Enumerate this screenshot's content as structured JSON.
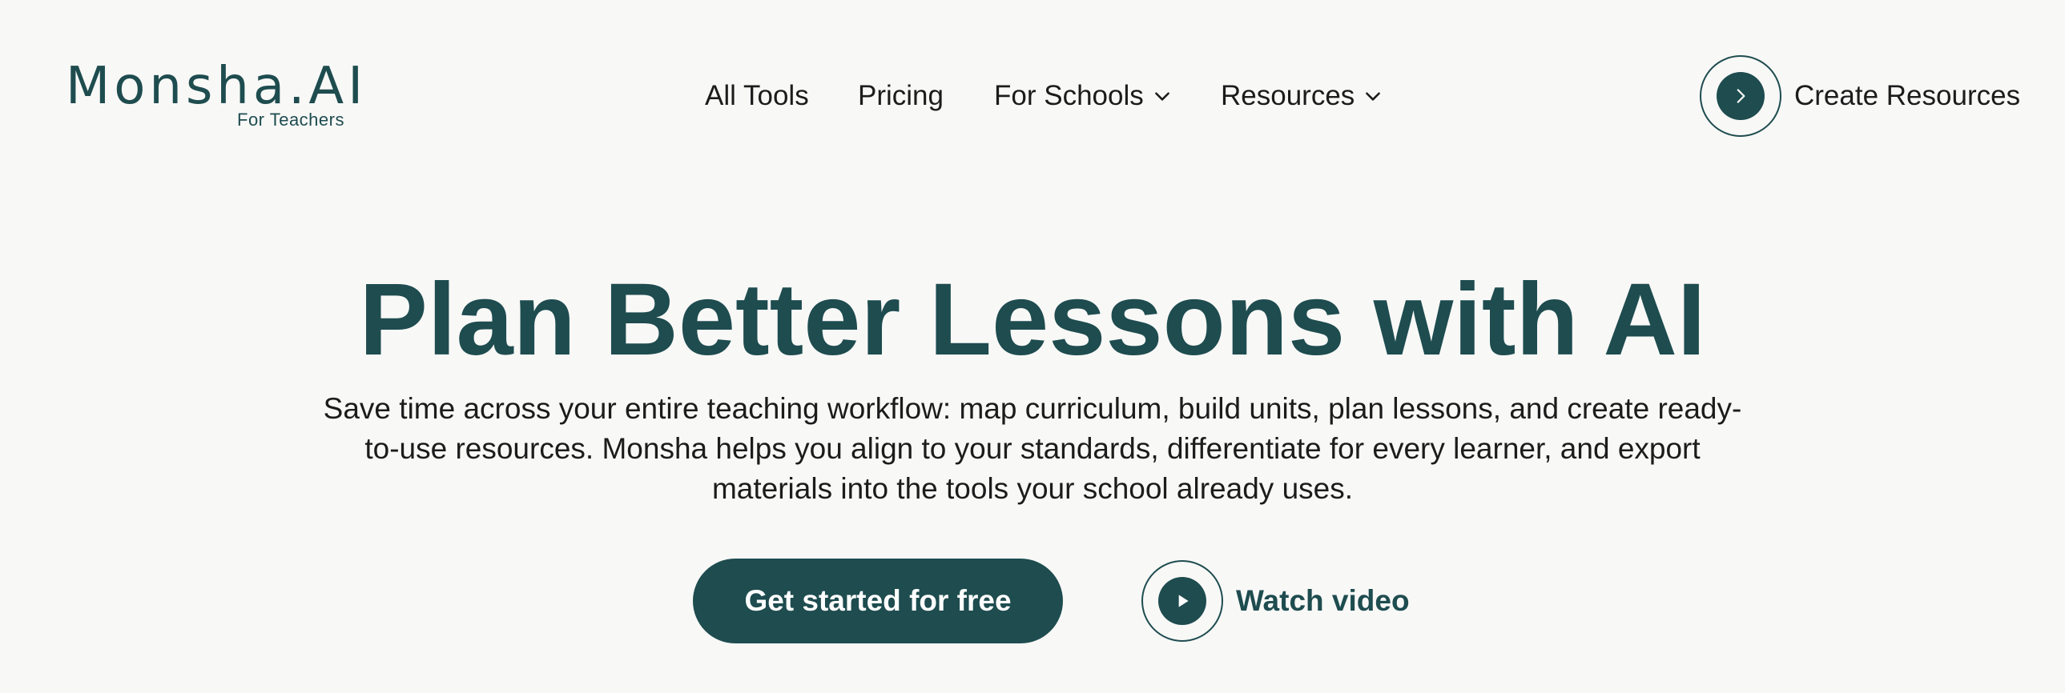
{
  "brand": {
    "name": "Monsha.AI",
    "tagline": "For Teachers",
    "color": "#1e4c4f"
  },
  "nav": {
    "items": [
      {
        "label": "All Tools"
      },
      {
        "label": "Pricing"
      },
      {
        "label": "For Schools",
        "icon": "chevron-down-icon"
      },
      {
        "label": "Resources",
        "icon": "chevron-down-icon"
      }
    ],
    "cta": {
      "label": "Create Resources",
      "icon": "chevron-right-icon"
    }
  },
  "hero": {
    "title": "Plan Better Lessons with AI",
    "description": "Save time across your entire teaching workflow: map curriculum, build units, plan lessons, and create ready-to-use resources. Monsha helps you align to your standards, differentiate for every learner, and export materials into the tools your school already uses.",
    "primary_button": "Get started for free",
    "secondary_button": {
      "label": "Watch video",
      "icon": "play-icon"
    }
  }
}
